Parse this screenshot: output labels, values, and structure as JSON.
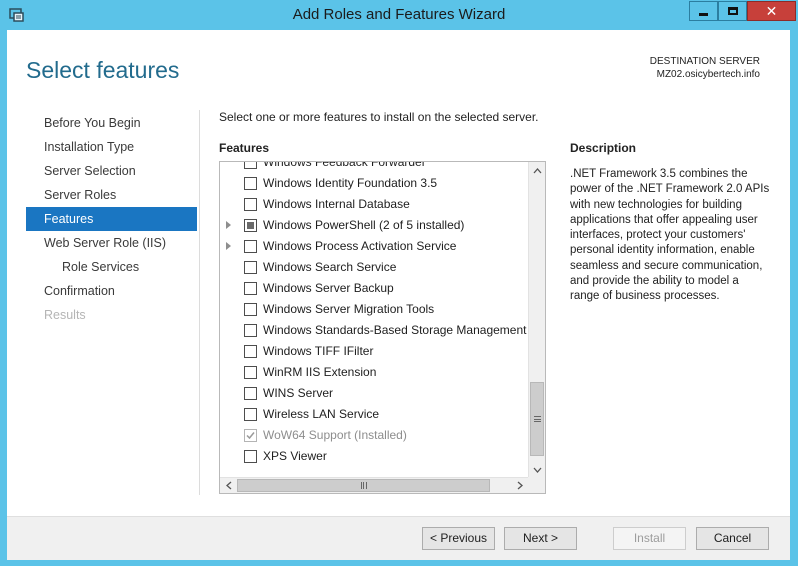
{
  "window": {
    "title": "Add Roles and Features Wizard",
    "close_glyph": "✕"
  },
  "header": {
    "page_title": "Select features",
    "destination_label": "DESTINATION SERVER",
    "destination_server": "MZ02.osicybertech.info"
  },
  "nav": {
    "items": [
      {
        "label": "Before You Begin",
        "state": "normal"
      },
      {
        "label": "Installation Type",
        "state": "normal"
      },
      {
        "label": "Server Selection",
        "state": "normal"
      },
      {
        "label": "Server Roles",
        "state": "normal"
      },
      {
        "label": "Features",
        "state": "active"
      },
      {
        "label": "Web Server Role (IIS)",
        "state": "normal"
      },
      {
        "label": "Role Services",
        "state": "sub"
      },
      {
        "label": "Confirmation",
        "state": "normal"
      },
      {
        "label": "Results",
        "state": "disabled"
      }
    ]
  },
  "main": {
    "instruction": "Select one or more features to install on the selected server.",
    "features_label": "Features",
    "features": [
      {
        "label": "Windows Feedback Forwarder",
        "checked": "none",
        "expandable": false,
        "enabled": true
      },
      {
        "label": "Windows Identity Foundation 3.5",
        "checked": "none",
        "expandable": false,
        "enabled": true
      },
      {
        "label": "Windows Internal Database",
        "checked": "none",
        "expandable": false,
        "enabled": true
      },
      {
        "label": "Windows PowerShell (2 of 5 installed)",
        "checked": "partial",
        "expandable": true,
        "enabled": true
      },
      {
        "label": "Windows Process Activation Service",
        "checked": "none",
        "expandable": true,
        "enabled": true
      },
      {
        "label": "Windows Search Service",
        "checked": "none",
        "expandable": false,
        "enabled": true
      },
      {
        "label": "Windows Server Backup",
        "checked": "none",
        "expandable": false,
        "enabled": true
      },
      {
        "label": "Windows Server Migration Tools",
        "checked": "none",
        "expandable": false,
        "enabled": true
      },
      {
        "label": "Windows Standards-Based Storage Management",
        "checked": "none",
        "expandable": false,
        "enabled": true
      },
      {
        "label": "Windows TIFF IFilter",
        "checked": "none",
        "expandable": false,
        "enabled": true
      },
      {
        "label": "WinRM IIS Extension",
        "checked": "none",
        "expandable": false,
        "enabled": true
      },
      {
        "label": "WINS Server",
        "checked": "none",
        "expandable": false,
        "enabled": true
      },
      {
        "label": "Wireless LAN Service",
        "checked": "none",
        "expandable": false,
        "enabled": true
      },
      {
        "label": "WoW64 Support (Installed)",
        "checked": "checked",
        "expandable": false,
        "enabled": false
      },
      {
        "label": "XPS Viewer",
        "checked": "none",
        "expandable": false,
        "enabled": true
      }
    ],
    "description_label": "Description",
    "description_text": ".NET Framework 3.5 combines the power of the .NET Framework 2.0 APIs with new technologies for building applications that offer appealing user interfaces, protect your customers' personal identity information, enable seamless and secure communication, and provide the ability to model a range of business processes."
  },
  "footer": {
    "previous_label": "< Previous",
    "next_label": "Next >",
    "install_label": "Install",
    "cancel_label": "Cancel"
  },
  "colors": {
    "accent": "#1a76c2",
    "title_bar": "#5bc3e8",
    "page_title": "#226b8d",
    "close_button": "#c7403a"
  },
  "icons": {
    "app": "server-manager-icon",
    "minimize": "minimize-icon",
    "maximize": "maximize-icon",
    "close": "close-icon"
  }
}
